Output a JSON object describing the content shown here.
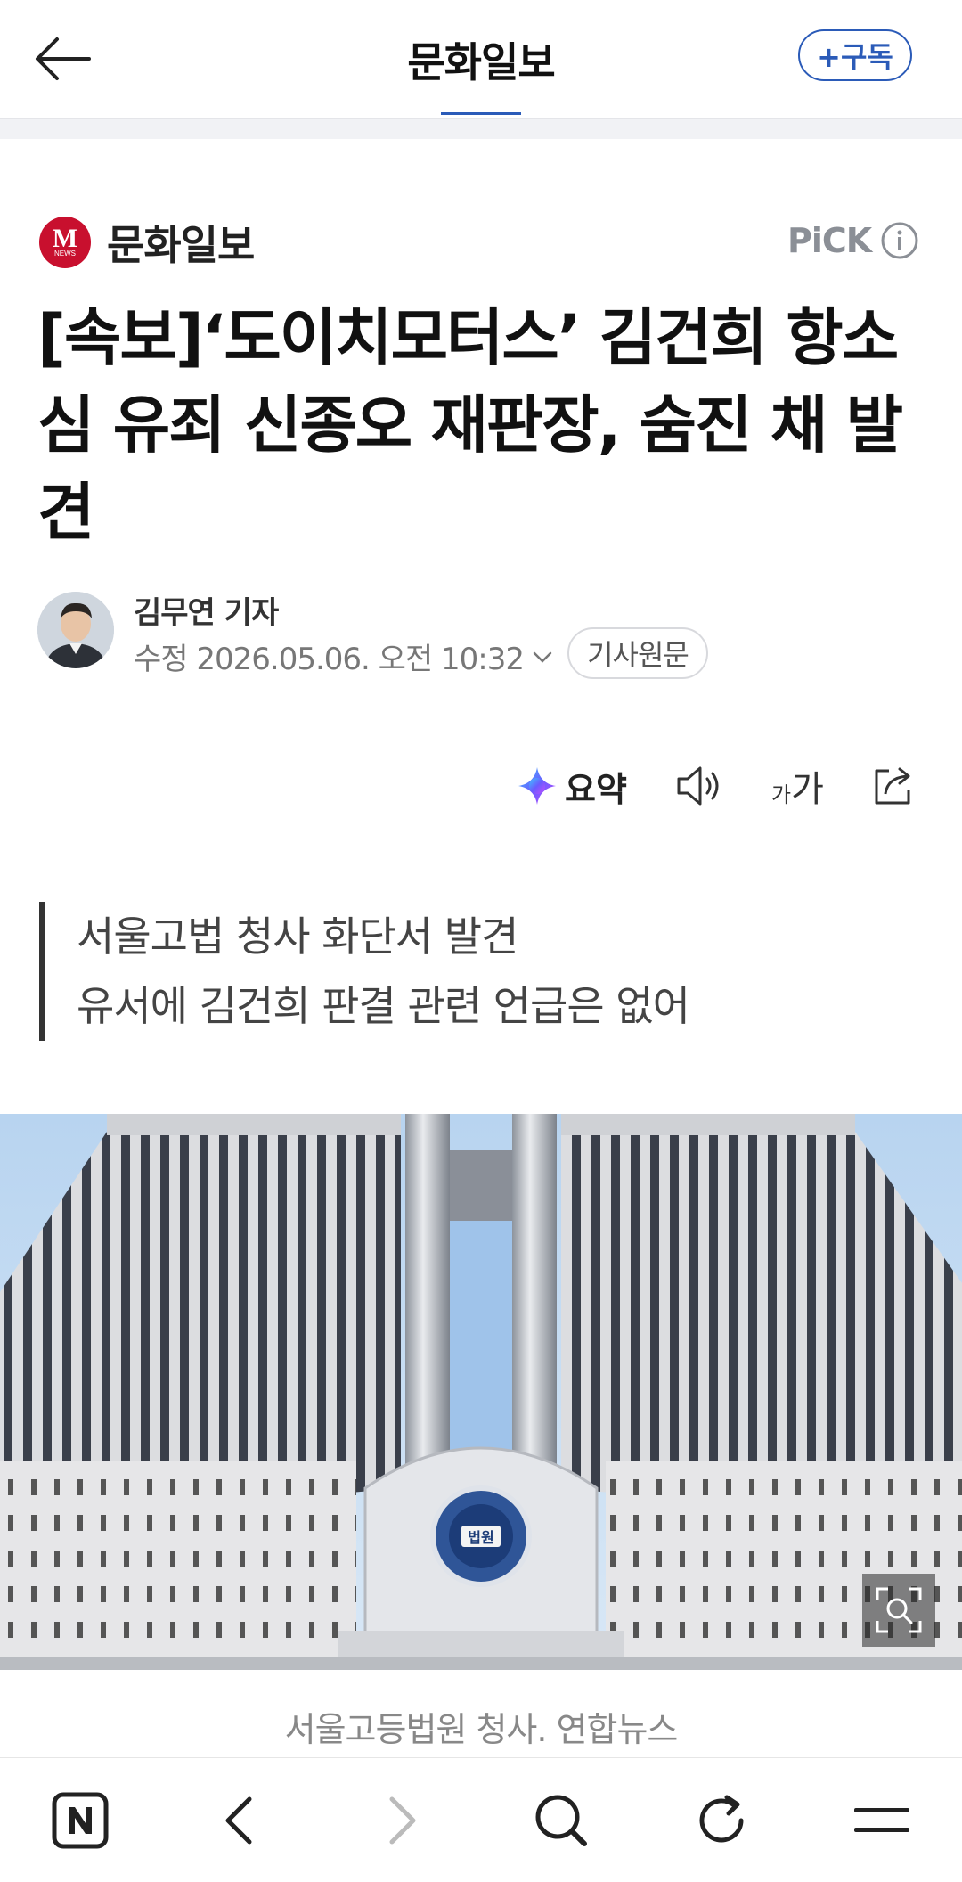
{
  "topbar": {
    "title": "문화일보",
    "subscribe_label": "+구독"
  },
  "article": {
    "press_name": "문화일보",
    "press_logo_letter": "M",
    "press_logo_sub": "NEWS",
    "pick_label": "PiCK",
    "headline": "[속보]‘도이치모터스’ 김건희 항소심 유죄 신종오 재판장, 숨진 채 발견",
    "reporter": "김무연 기자",
    "date": "수정 2026.05.06. 오전 10:32",
    "original_button": "기사원문",
    "summary_label": "요약",
    "font_size_label_small": "가",
    "font_size_label_large": "가",
    "subtitle_lines": [
      "서울고법 청사 화단서 발견",
      "유서에 김건희 판결 관련 언급은 없어"
    ],
    "court_emblem_text": "법원",
    "photo_caption": "서울고등법원 청사. 연합뉴스"
  },
  "colors": {
    "accent": "#2b5bb8",
    "press_red": "#c8102e",
    "text_main": "#111111",
    "text_muted": "#777777"
  },
  "icons": {
    "back": "arrow-left-icon",
    "info": "info-icon",
    "summary": "ai-sparkle-icon",
    "tts": "speaker-icon",
    "font": "font-size-icon",
    "share": "share-icon",
    "zoom": "zoom-icon",
    "nav_home": "naver-n-icon",
    "nav_back": "chevron-left-icon",
    "nav_forward": "chevron-right-icon",
    "nav_search": "search-icon",
    "nav_refresh": "refresh-icon",
    "nav_menu": "menu-icon"
  }
}
